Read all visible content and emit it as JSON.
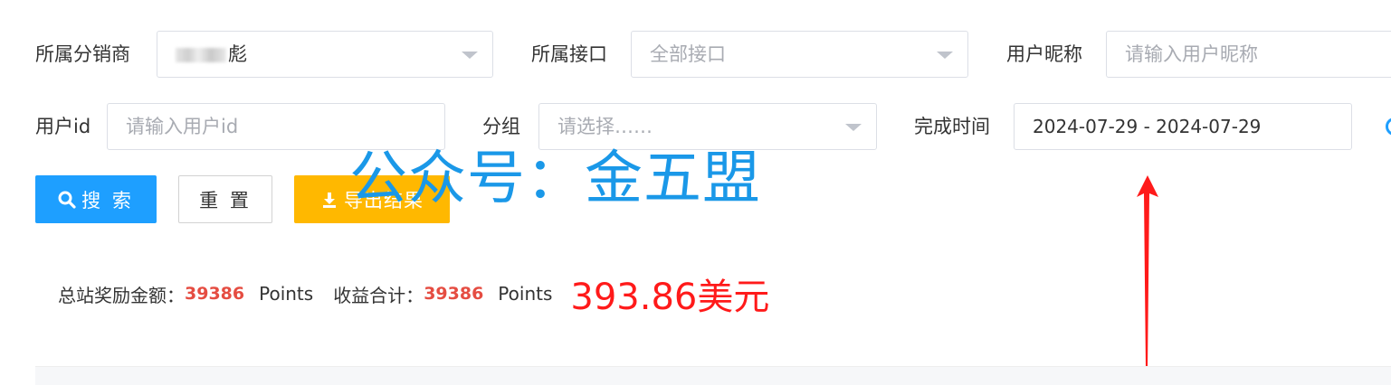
{
  "filters": {
    "distributor": {
      "label": "所属分销商",
      "value": "彪"
    },
    "interface": {
      "label": "所属接口",
      "placeholder": "全部接口"
    },
    "nickname": {
      "label": "用户昵称",
      "placeholder": "请输入用户昵称"
    },
    "user_id": {
      "label": "用户id",
      "placeholder": "请输入用户id"
    },
    "group": {
      "label": "分组",
      "placeholder": "请选择……"
    },
    "completion_time": {
      "label": "完成时间",
      "value": "2024-07-29 - 2024-07-29"
    }
  },
  "buttons": {
    "search": "搜 索",
    "reset": "重 置",
    "export": "导出结果"
  },
  "watermark": "公众号：金五盟",
  "stats": {
    "total_reward_label": "总站奖励金额：",
    "total_reward_value": "39386",
    "total_reward_unit": "Points",
    "income_label": "收益合计：",
    "income_value": "39386",
    "income_unit": "Points",
    "usd_total": "393.86美元"
  },
  "colors": {
    "primary": "#1e9fff",
    "warning": "#ffb800",
    "highlight_number": "#e54d42",
    "annotation_red": "#ff1a1a",
    "watermark_blue": "#1a98e8"
  }
}
